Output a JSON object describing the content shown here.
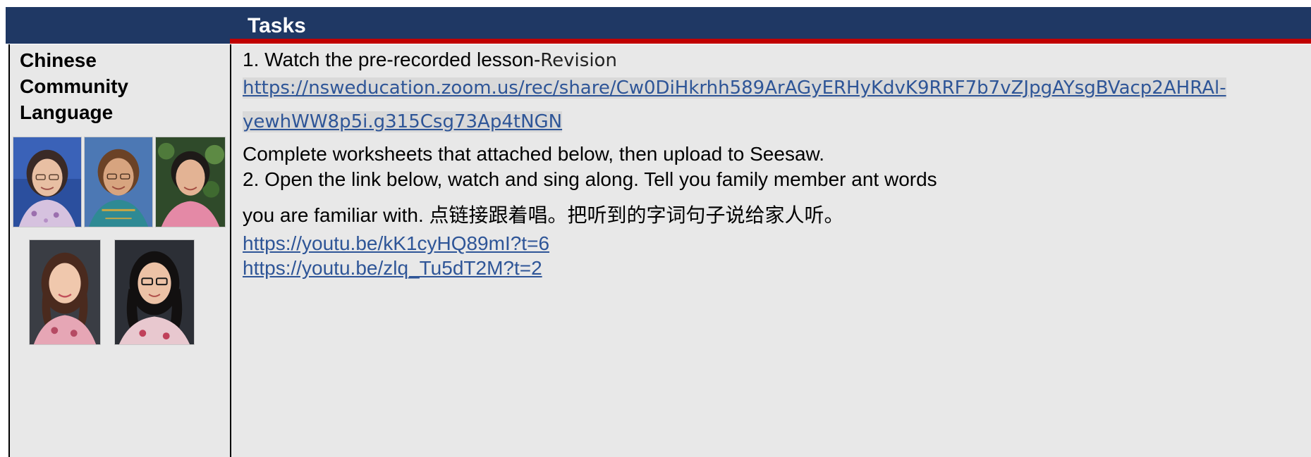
{
  "header": {
    "title": "Tasks"
  },
  "subject": {
    "line1": "Chinese",
    "line2": "Community",
    "line3": "Language"
  },
  "tasks": {
    "step1_prefix": "1. Watch the pre-recorded lesson-",
    "step1_suffix": "Revision",
    "zoom_link_line1": "https://nsweducation.zoom.us/rec/share/Cw0DiHkrhh589ArAGyERHyKdvK9RRF7b7vZJpgAYsgBVacp2AHRAl-",
    "zoom_link_line2": "yewhWW8p5i.g315Csg73Ap4tNGN",
    "worksheets": "Complete worksheets that attached below, then upload to Seesaw.",
    "step2_line1": "2. Open the link below, watch and sing along. Tell you family member ant words",
    "step2_line2": "you are familiar with. 点链接跟着唱。把听到的字词句子说给家人听。",
    "youtube_link_1": "https://youtu.be/kK1cyHQ89mI?t=6",
    "youtube_link_2": "https://youtu.be/zlq_Tu5dT2M?t=2"
  },
  "colors": {
    "header_bg": "#1f3864",
    "accent_red": "#c00000",
    "cell_bg": "#e8e8e8",
    "link": "#2e5597"
  }
}
